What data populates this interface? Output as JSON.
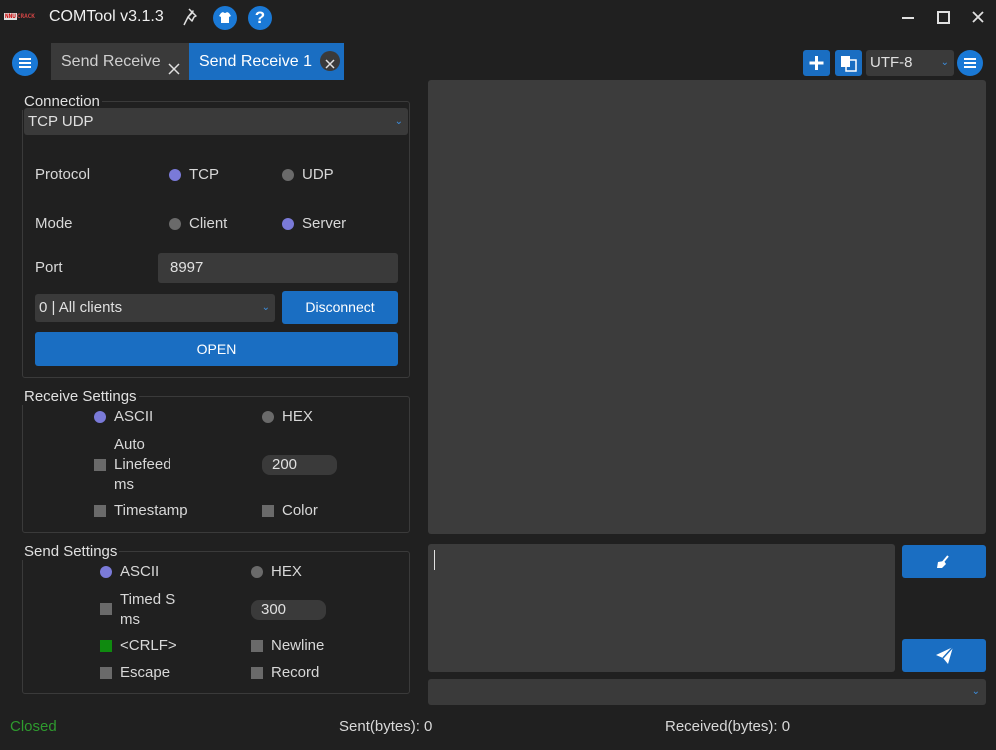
{
  "window": {
    "title": "COMTool v3.1.3",
    "logo_text_a": "NNU",
    "logo_text_b": "CRACK",
    "help_glyph": "?"
  },
  "tabs": [
    {
      "label": "Send Receive"
    },
    {
      "label": "Send Receive 1",
      "active": true
    }
  ],
  "toolbar": {
    "encoding": "UTF-8"
  },
  "connection": {
    "title": "Connection",
    "type": "TCP UDP",
    "protocol_label": "Protocol",
    "protocol_options": [
      "TCP",
      "UDP"
    ],
    "protocol_selected": "TCP",
    "mode_label": "Mode",
    "mode_options": [
      "Client",
      "Server"
    ],
    "mode_selected": "Server",
    "port_label": "Port",
    "port_value": "8997",
    "clients_value": "0 | All clients",
    "disconnect_label": "Disconnect",
    "open_label": "OPEN"
  },
  "receive_settings": {
    "title": "Receive Settings",
    "ascii_label": "ASCII",
    "hex_label": "HEX",
    "format_selected": "ASCII",
    "auto_linefeed_label_1": "Auto",
    "auto_linefeed_label_2": "Linefeed",
    "auto_linefeed_label_3": "ms",
    "auto_linefeed_checked": false,
    "auto_linefeed_ms": "200",
    "timestamp_label": "Timestamp",
    "timestamp_checked": false,
    "color_label": "Color",
    "color_checked": false
  },
  "send_settings": {
    "title": "Send Settings",
    "ascii_label": "ASCII",
    "hex_label": "HEX",
    "format_selected": "ASCII",
    "timed_label_1": "Timed Send",
    "timed_label_2": "ms",
    "timed_checked": false,
    "timed_ms": "300",
    "crlf_label": "<CRLF>",
    "crlf_checked": true,
    "newline_label": "Newline",
    "newline_checked": false,
    "escape_label": "Escape",
    "escape_checked": false,
    "record_label": "Record",
    "record_checked": false
  },
  "status_bar": {
    "state": "Closed",
    "sent": "Sent(bytes): 0",
    "received": "Received(bytes): 0"
  },
  "colors": {
    "accent": "#1a6ec2",
    "radio_on": "#7a7ad8",
    "closed_status": "#2e9a2e"
  }
}
